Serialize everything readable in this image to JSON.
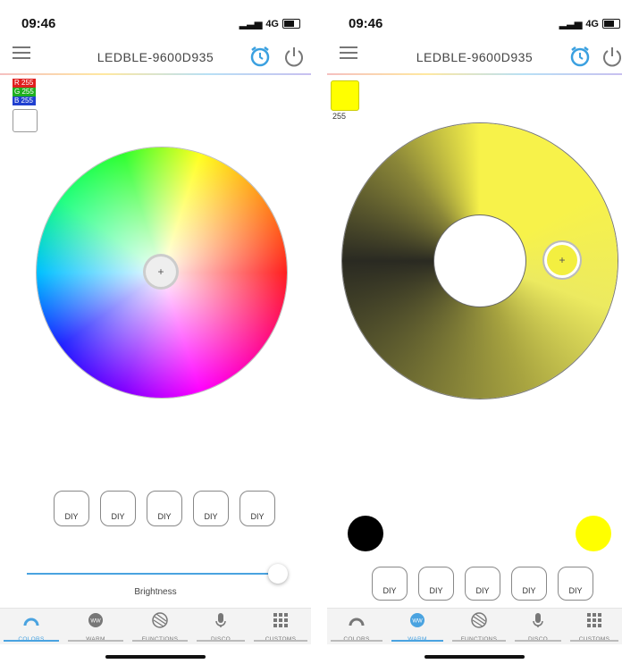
{
  "status_bar": {
    "time": "09:46",
    "network": "4G"
  },
  "header": {
    "title": "LEDBLE-9600D935"
  },
  "left_screen": {
    "rgb": {
      "r": "R 255",
      "g": "G 255",
      "b": "B 255"
    },
    "brightness_label": "Brightness",
    "brightness_level": 0.97,
    "selected_color": "#ffffff"
  },
  "right_screen": {
    "warm_value": "255",
    "selected_color": "#ffff00"
  },
  "diy_label": "DIY",
  "tabs": [
    {
      "label": "COLORS",
      "icon": "colors-icon"
    },
    {
      "label": "WARM",
      "icon": "warm-icon"
    },
    {
      "label": "FUNCTIONS",
      "icon": "functions-icon"
    },
    {
      "label": "DISCO",
      "icon": "microphone-icon"
    },
    {
      "label": "CUSTOMS",
      "icon": "grid-icon"
    }
  ],
  "colors": {
    "accent": "#4aa3e0",
    "alarm": "#3aa0e0",
    "warm_yellow": "#f7f24a"
  }
}
